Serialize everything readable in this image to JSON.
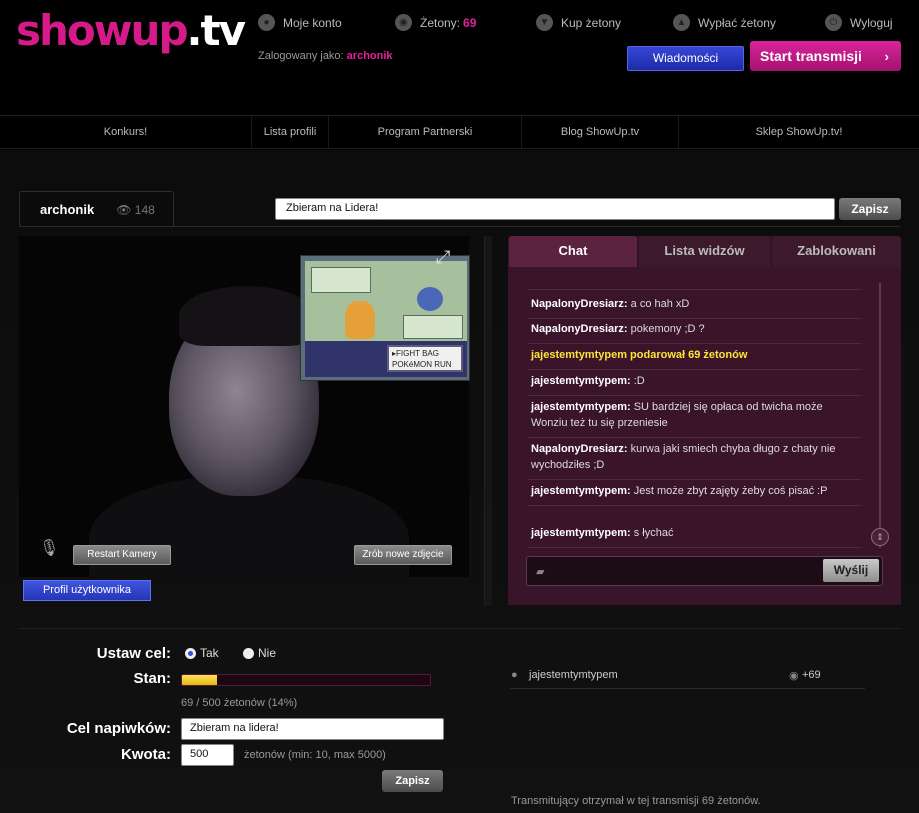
{
  "logo": {
    "main": "showup",
    "tld": ".tv"
  },
  "header": {
    "my_account": "Moje konto",
    "tokens_label": "Żetony:",
    "tokens_value": "69",
    "buy_tokens": "Kup żetony",
    "withdraw_tokens": "Wypłać żetony",
    "logout": "Wyloguj",
    "logged_as_label": "Zalogowany jako:",
    "logged_as_user": "archonik",
    "messages_button": "Wiadomości",
    "start_button": "Start transmisji",
    "start_arrow": "›"
  },
  "nav": [
    "Konkurs!",
    "Lista profili",
    "Program Partnerski",
    "Blog ShowUp.tv",
    "Sklep ShowUp.tv!"
  ],
  "profile": {
    "name": "archonik",
    "viewers": "148"
  },
  "status": {
    "value": "Zbieram na Lidera!",
    "save": "Zapisz"
  },
  "video": {
    "restart_camera": "Restart Kamery",
    "new_photo": "Zrób nowe zdjęcie",
    "user_profile": "Profil użytkownika",
    "game_menu": "▸FIGHT BAG\nPOKéMON RUN"
  },
  "chat": {
    "tabs": [
      "Chat",
      "Lista widzów",
      "Zablokowani"
    ],
    "messages": [
      {
        "user": "NapalonyDresiarz:",
        "text": "a co hah xD"
      },
      {
        "user": "NapalonyDresiarz:",
        "text": "pokemony ;D ?"
      },
      {
        "user": "jajestemtymtypem podarował 69 żetonów",
        "text": ""
      },
      {
        "user": "jajestemtymtypem:",
        "text": ":D"
      },
      {
        "user": "jajestemtymtypem:",
        "text": "SU bardziej się opłaca od twicha może Wonziu też tu się przeniesie"
      },
      {
        "user": "NapalonyDresiarz:",
        "text": "kurwa jaki smiech chyba długo z chaty nie wychodziłes ;D"
      },
      {
        "user": "jajestemtymtypem:",
        "text": "Jest może zbyt zajęty żeby coś pisać :P"
      },
      {
        "user": "jajestemtymtypem:",
        "text": "s łychać"
      }
    ],
    "send": "Wyślij"
  },
  "goal": {
    "set_goal_label": "Ustaw cel:",
    "yes": "Tak",
    "no": "Nie",
    "state_label": "Stan:",
    "progress_fraction": 0.14,
    "progress_text": "69 / 500 żetonów (14%)",
    "tip_goal_label": "Cel napiwków:",
    "tip_goal_value": "Zbieram na lidera!",
    "amount_label": "Kwota:",
    "amount_value": "500",
    "amount_hint": "żetonów (min: 10, max 5000)",
    "save": "Zapisz"
  },
  "donors": [
    {
      "name": "jajestemtymtypem",
      "amount": "+69"
    }
  ],
  "summary": "Transmitujący otrzymał w tej transmisji 69 żetonów.",
  "colors": {
    "brand": "#d61a8a",
    "chat_bg": "#3a1529",
    "gift": "#ffe33a",
    "progress": "#f2c617"
  }
}
